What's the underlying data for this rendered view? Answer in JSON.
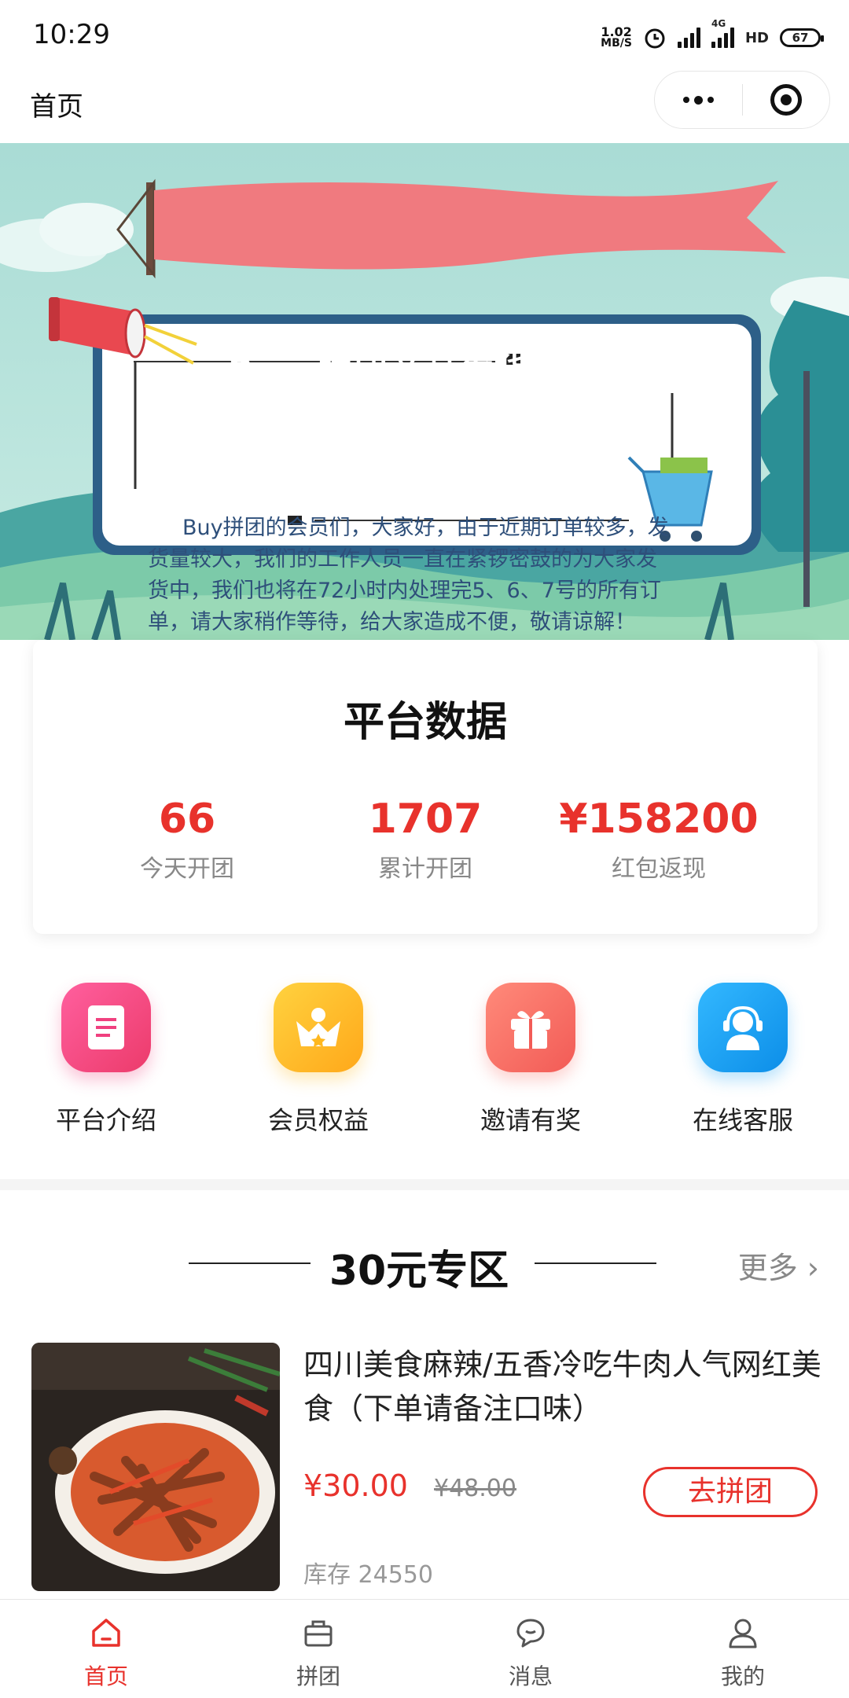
{
  "status_bar": {
    "time": "10:29",
    "net_speed_value": "1.02",
    "net_speed_unit": "MB/S",
    "network": "4G",
    "hd": "HD",
    "battery": "67"
  },
  "nav": {
    "title": "首页"
  },
  "banner": {
    "ribbon_text": "Buy 拼团商品发货通知",
    "notice_text": "Buy拼团的会员们，大家好，由于近期订单较多，发货量较大，我们的工作人员一直在紧锣密鼓的为大家发货中，我们也将在72小时内处理完5、6、7号的所有订单，请大家稍作等待，给大家造成不便，敬请谅解！",
    "slide_count": 7,
    "active_slide": 7
  },
  "stats": {
    "title": "平台数据",
    "items": [
      {
        "value": "66",
        "label": "今天开团"
      },
      {
        "value": "1707",
        "label": "累计开团"
      },
      {
        "value": "¥158200",
        "label": "红包返现"
      }
    ]
  },
  "menu": {
    "items": [
      {
        "label": "平台介绍",
        "icon": "document-icon",
        "color": "#f0407f"
      },
      {
        "label": "会员权益",
        "icon": "crown-icon",
        "color": "#ffb81f"
      },
      {
        "label": "邀请有奖",
        "icon": "gift-icon",
        "color": "#fa6b63"
      },
      {
        "label": "在线客服",
        "icon": "headset-icon",
        "color": "#1aa2f5"
      }
    ]
  },
  "section": {
    "title": "30元专区",
    "more": "更多"
  },
  "product": {
    "name": "四川美食麻辣/五香冷吃牛肉人气网红美食（下单请备注口味）",
    "price": "¥30.00",
    "original_price": "¥48.00",
    "button": "去拼团",
    "stock": "库存 24550"
  },
  "tabs": [
    {
      "label": "首页",
      "icon": "home-icon",
      "active": true
    },
    {
      "label": "拼团",
      "icon": "bag-icon",
      "active": false
    },
    {
      "label": "消息",
      "icon": "chat-icon",
      "active": false
    },
    {
      "label": "我的",
      "icon": "user-icon",
      "active": false
    }
  ],
  "colors": {
    "accent": "#e8322c",
    "banner_bg": "#a8d8d0",
    "ribbon": "#f07a7f"
  }
}
